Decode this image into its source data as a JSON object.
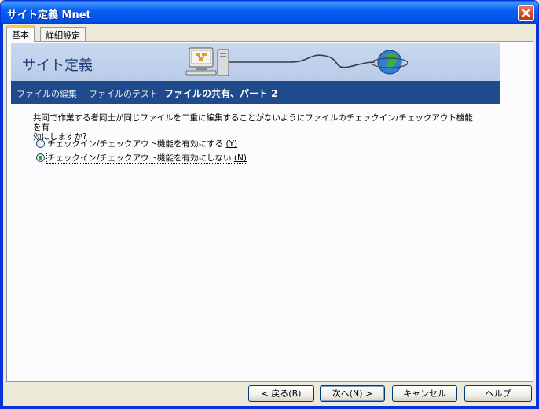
{
  "window": {
    "title": "サイト定義 Mnet"
  },
  "tabs": [
    {
      "label": "基本",
      "active": true
    },
    {
      "label": "詳細設定",
      "active": false
    }
  ],
  "banner": {
    "title": "サイト定義"
  },
  "nav": {
    "items": [
      {
        "label": "ファイルの編集"
      },
      {
        "label": "ファイルのテスト"
      },
      {
        "label": "ファイルの共有、パート 2",
        "current": true
      }
    ]
  },
  "content": {
    "question_line1": "共同で作業する者同士が同じファイルを二重に編集することがないようにファイルのチェックイン/チェックアウト機能を有",
    "question_line2": "効にしますか?",
    "options": [
      {
        "label": "チェックイン/チェックアウト機能を有効にする",
        "mnemonic": "(Y)",
        "checked": false
      },
      {
        "label": "チェックイン/チェックアウト機能を有効にしない",
        "mnemonic": "(N)",
        "checked": true
      }
    ]
  },
  "buttons": {
    "back": "< 戻る(B)",
    "next": "次へ(N) >",
    "cancel": "キャンセル",
    "help": "ヘルプ"
  },
  "colors": {
    "titlebar": "#0a5ff0",
    "banner": "#c8d8ef",
    "navbar": "#1f4a8b",
    "radio_dot": "#21a121"
  }
}
